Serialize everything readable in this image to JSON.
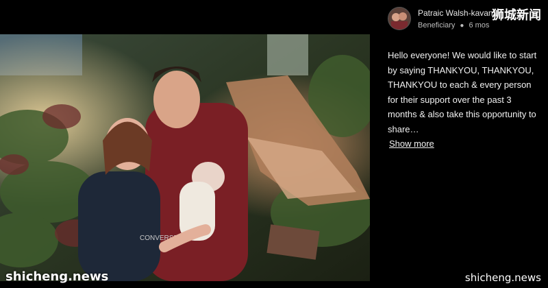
{
  "post": {
    "author": "Patraic Walsh-kavanagh",
    "role": "Beneficiary",
    "age": "6 mos",
    "body": "Hello everyone! We would like to start by saying THANKYOU, THANKYOU, THANKYOU to each & every person for their support over the past 3 months & also take this opportunity to share…",
    "show_more": "Show more",
    "shirt_text": "CONVERSE"
  },
  "watermarks": {
    "top": "狮城新闻",
    "bottom_left": "shicheng.news",
    "bottom_right": "shicheng.news"
  },
  "colors": {
    "background": "#000000",
    "text": "#f2f2f2",
    "muted": "#bdbdbd"
  },
  "icons": [
    "avatar-photo",
    "bullet-dot"
  ]
}
